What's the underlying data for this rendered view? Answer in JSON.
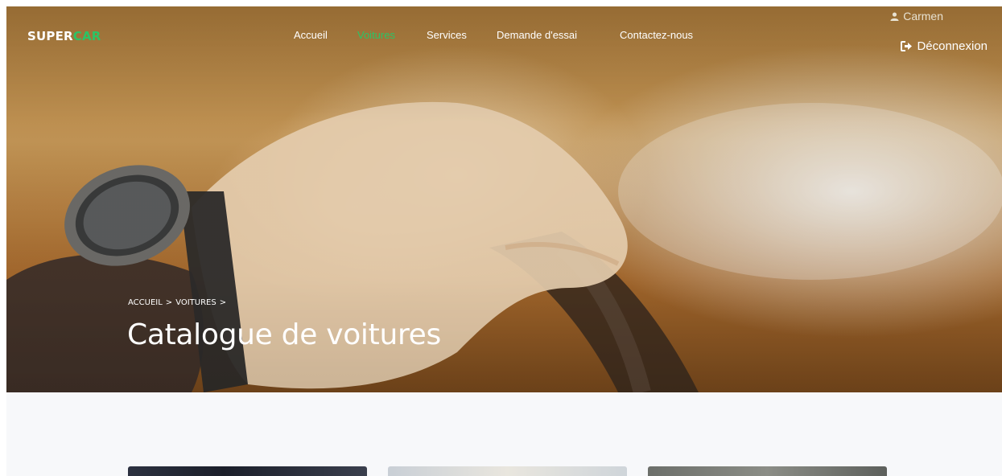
{
  "brand": {
    "part1": "SUPER",
    "part2": "CAR"
  },
  "nav": {
    "items": [
      {
        "label": "Accueil",
        "active": false
      },
      {
        "label": "Voitures",
        "active": true
      },
      {
        "label": "Services",
        "active": false
      },
      {
        "label": "Demande d'essai",
        "active": false
      },
      {
        "label": "Contactez-nous",
        "active": false
      }
    ]
  },
  "user": {
    "name": "Carmen",
    "icon": "user-icon"
  },
  "logout": {
    "label": "Déconnexion",
    "icon": "sign-out-icon"
  },
  "breadcrumb": {
    "items": [
      "ACCUEIL",
      "VOITURES"
    ],
    "separator": ">"
  },
  "hero": {
    "title": "Catalogue de voitures"
  },
  "colors": {
    "accent": "#2bc466",
    "text_on_hero": "#ffffff",
    "section_bg": "#f7f8fa"
  }
}
